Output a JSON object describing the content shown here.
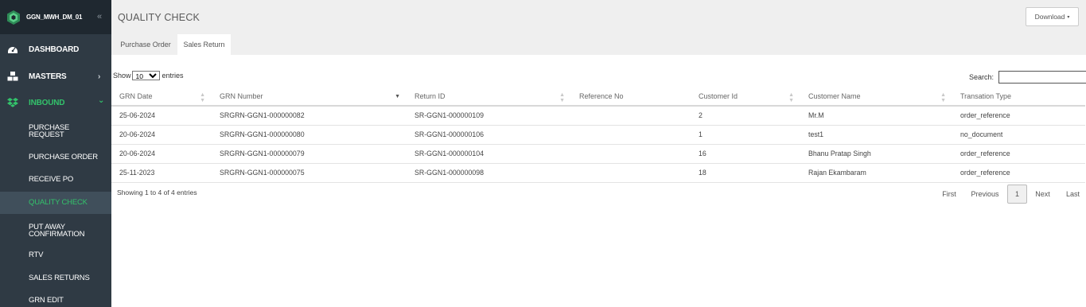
{
  "sidebar": {
    "brand": "GGN_MWH_DM_01",
    "collapse_icon": "«",
    "items": [
      {
        "label": "DASHBOARD",
        "icon": "dashboard-icon",
        "chevron": ""
      },
      {
        "label": "MASTERS",
        "icon": "cubes-icon",
        "chevron": "›"
      },
      {
        "label": "INBOUND",
        "icon": "dropbox-icon",
        "chevron": "⌄"
      }
    ],
    "sub_items": [
      {
        "label": "PURCHASE REQUEST"
      },
      {
        "label": "PURCHASE ORDER"
      },
      {
        "label": "RECEIVE PO"
      },
      {
        "label": "QUALITY CHECK"
      },
      {
        "label": "PUT AWAY CONFIRMATION"
      },
      {
        "label": "RTV"
      },
      {
        "label": "SALES RETURNS"
      },
      {
        "label": "GRN EDIT"
      }
    ],
    "accent_color": "#33c26b"
  },
  "header": {
    "title": "QUALITY CHECK",
    "download_label": "Download",
    "download_caret": "▾",
    "tabs": [
      {
        "label": "Purchase Order"
      },
      {
        "label": "Sales Return"
      }
    ]
  },
  "table_controls": {
    "show_prefix": "Show",
    "page_size": "10",
    "show_suffix": "entries",
    "search_label": "Search:",
    "search_value": ""
  },
  "table": {
    "columns": [
      "GRN Date",
      "GRN Number",
      "Return ID",
      "Reference No",
      "Customer Id",
      "Customer Name",
      "Transation Type"
    ],
    "rows": [
      [
        "25-06-2024",
        "SRGRN-GGN1-000000082",
        "SR-GGN1-000000109",
        "",
        "2",
        "Mr.M",
        "order_reference"
      ],
      [
        "20-06-2024",
        "SRGRN-GGN1-000000080",
        "SR-GGN1-000000106",
        "",
        "1",
        "test1",
        "no_document"
      ],
      [
        "20-06-2024",
        "SRGRN-GGN1-000000079",
        "SR-GGN1-000000104",
        "",
        "16",
        "Bhanu Pratap Singh",
        "order_reference"
      ],
      [
        "25-11-2023",
        "SRGRN-GGN1-000000075",
        "SR-GGN1-000000098",
        "",
        "18",
        "Rajan Ekambaram",
        "order_reference"
      ]
    ]
  },
  "footer": {
    "info": "Showing 1 to 4 of 4 entries",
    "pager": {
      "first": "First",
      "previous": "Previous",
      "current": "1",
      "next": "Next",
      "last": "Last"
    }
  }
}
